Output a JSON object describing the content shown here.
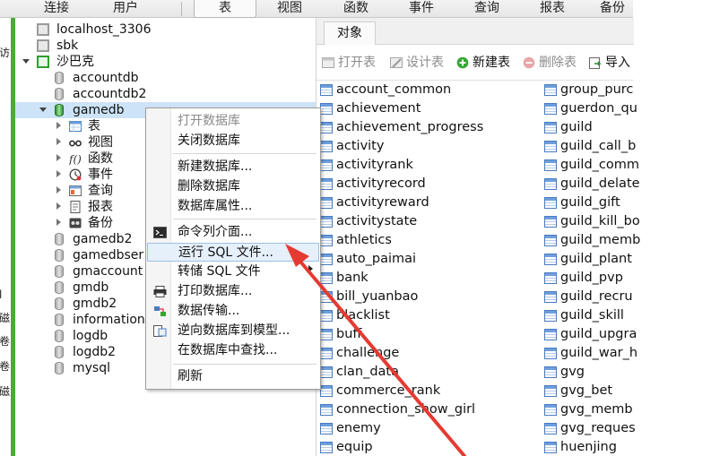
{
  "toolbar": {
    "items": [
      "连接",
      "用户",
      "表",
      "视图",
      "函数",
      "事件",
      "查询",
      "报表",
      "备份"
    ],
    "active": "表"
  },
  "left_strip_chars": [
    "访",
    "l",
    "磁",
    "卷",
    "卷",
    "磁"
  ],
  "tree": {
    "items": [
      {
        "label": "localhost_3306",
        "type": "server-gray"
      },
      {
        "label": "sbk",
        "type": "server-gray"
      },
      {
        "label": "沙巴克",
        "type": "server-green"
      },
      {
        "label": "accountdb",
        "type": "db"
      },
      {
        "label": "accountdb2",
        "type": "db"
      },
      {
        "label": "gamedb",
        "type": "db-open"
      },
      {
        "label": "表",
        "type": "folder-table"
      },
      {
        "label": "视图",
        "type": "folder-view"
      },
      {
        "label": "函数",
        "type": "folder-func"
      },
      {
        "label": "事件",
        "type": "folder-event"
      },
      {
        "label": "查询",
        "type": "folder-query"
      },
      {
        "label": "报表",
        "type": "folder-report"
      },
      {
        "label": "备份",
        "type": "folder-backup"
      },
      {
        "label": "gamedb2",
        "type": "db"
      },
      {
        "label": "gamedbser",
        "type": "db"
      },
      {
        "label": "gmaccount",
        "type": "db"
      },
      {
        "label": "gmdb",
        "type": "db"
      },
      {
        "label": "gmdb2",
        "type": "db"
      },
      {
        "label": "information",
        "type": "db"
      },
      {
        "label": "logdb",
        "type": "db"
      },
      {
        "label": "logdb2",
        "type": "db"
      },
      {
        "label": "mysql",
        "type": "db"
      }
    ]
  },
  "objects": {
    "tab": "对象",
    "toolbar": {
      "open": "打开表",
      "design": "设计表",
      "new": "新建表",
      "delete": "删除表",
      "import": "导入"
    },
    "col1": [
      "account_common",
      "achievement",
      "achievement_progress",
      "activity",
      "activityrank",
      "activityrecord",
      "activityreward",
      "activitystate",
      "athletics",
      "auto_paimai",
      "bank",
      "bill_yuanbao",
      "blacklist",
      "buff",
      "challenge",
      "clan_data",
      "commerce_rank",
      "connection_show_girl",
      "enemy",
      "equip"
    ],
    "col2": [
      "group_purc",
      "guerdon_qu",
      "guild",
      "guild_call_b",
      "guild_comm",
      "guild_delate",
      "guild_gift",
      "guild_kill_bo",
      "guild_memb",
      "guild_plant",
      "guild_pvp",
      "guild_recru",
      "guild_skill",
      "guild_upgra",
      "guild_war_h",
      "gvg",
      "gvg_bet",
      "gvg_memb",
      "gvg_reques",
      "huenjing"
    ]
  },
  "context_menu": {
    "open_db": "打开数据库",
    "close_db": "关闭数据库",
    "new_db": "新建数据库...",
    "delete_db": "删除数据库",
    "db_props": "数据库属性...",
    "console": "命令列介面...",
    "run_sql": "运行 SQL 文件...",
    "dump_sql": "转储 SQL 文件",
    "print_db": "打印数据库...",
    "transfer": "数据传输...",
    "reverse": "逆向数据库到模型...",
    "find": "在数据库中查找...",
    "refresh": "刷新"
  },
  "colors": {
    "accent_green": "#4ea83a",
    "selection": "#cde3f7",
    "annotation_red": "#e53a32"
  }
}
